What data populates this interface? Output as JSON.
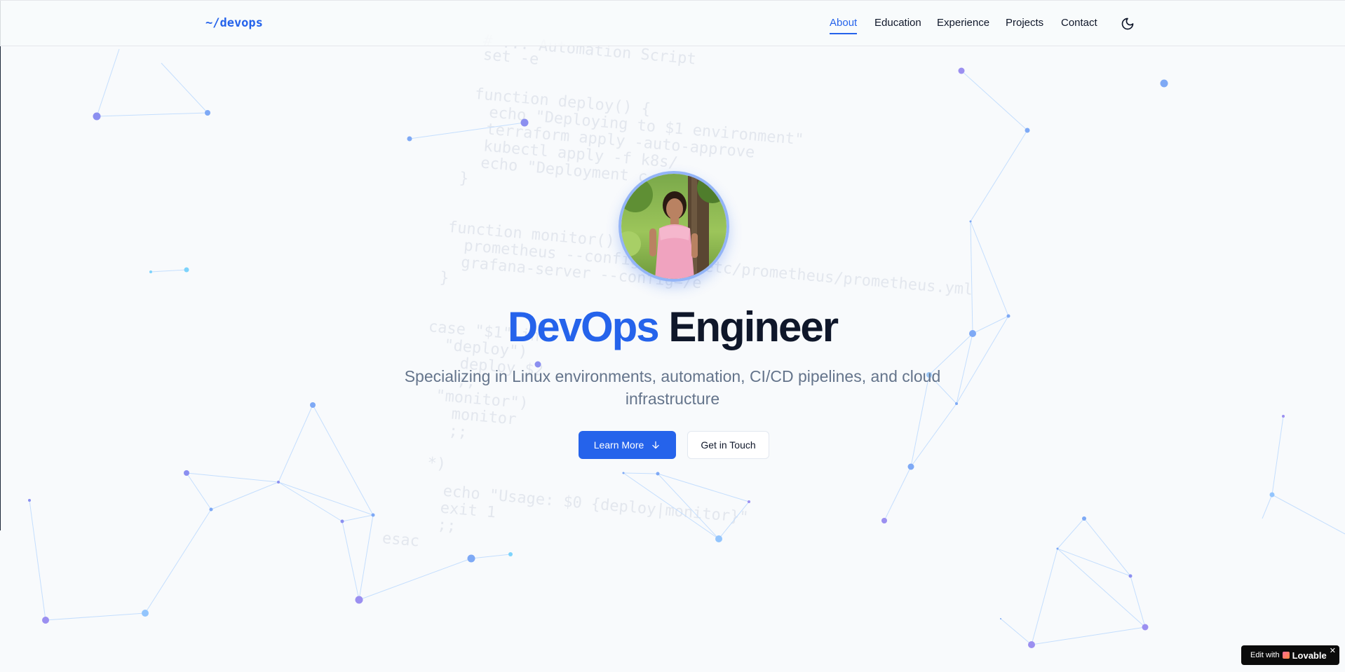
{
  "header": {
    "logo": "~/devops",
    "nav": [
      {
        "label": "About",
        "active": true
      },
      {
        "label": "Education",
        "active": false
      },
      {
        "label": "Experience",
        "active": false
      },
      {
        "label": "Projects",
        "active": false
      },
      {
        "label": "Contact",
        "active": false
      }
    ],
    "theme_toggle_icon": "moon-icon"
  },
  "hero": {
    "avatar_alt": "profile-photo",
    "title_accent": "DevOps",
    "title_rest": "Engineer",
    "subtitle": "Specializing in Linux environments, automation, CI/CD pipelines, and cloud infrastructure",
    "primary_button": "Learn More",
    "primary_button_icon": "arrow-down-icon",
    "secondary_button": "Get in Touch"
  },
  "background_code": [
    "set -e",
    "function deploy() {",
    "  echo \"Deploying to $1 environment\"",
    "  terraform apply -auto-approve",
    "  kubectl apply -f k8s/",
    "  echo \"Deployment c",
    "}",
    "function monitor() {",
    "  prometheus --config.file=/etc/prometheus/prometheus.yml",
    "  grafana-server --config=/e",
    "}",
    "case \"$1\" in",
    "  \"deploy\")",
    "    deploy $2",
    "    ;;",
    "  \"monitor\")",
    "    monitor",
    "    ;;",
    "  *)",
    "    echo \"Usage: $0 {deploy|monitor}\"",
    "    exit 1",
    "    ;;",
    "esac",
    "# ... Automation Script"
  ],
  "badge": {
    "prefix": "Edit with",
    "brand": "Lovable",
    "close": "✕"
  },
  "colors": {
    "accent": "#2563eb",
    "text": "#0f172a",
    "muted": "#64748b",
    "background": "#f8fafc"
  }
}
